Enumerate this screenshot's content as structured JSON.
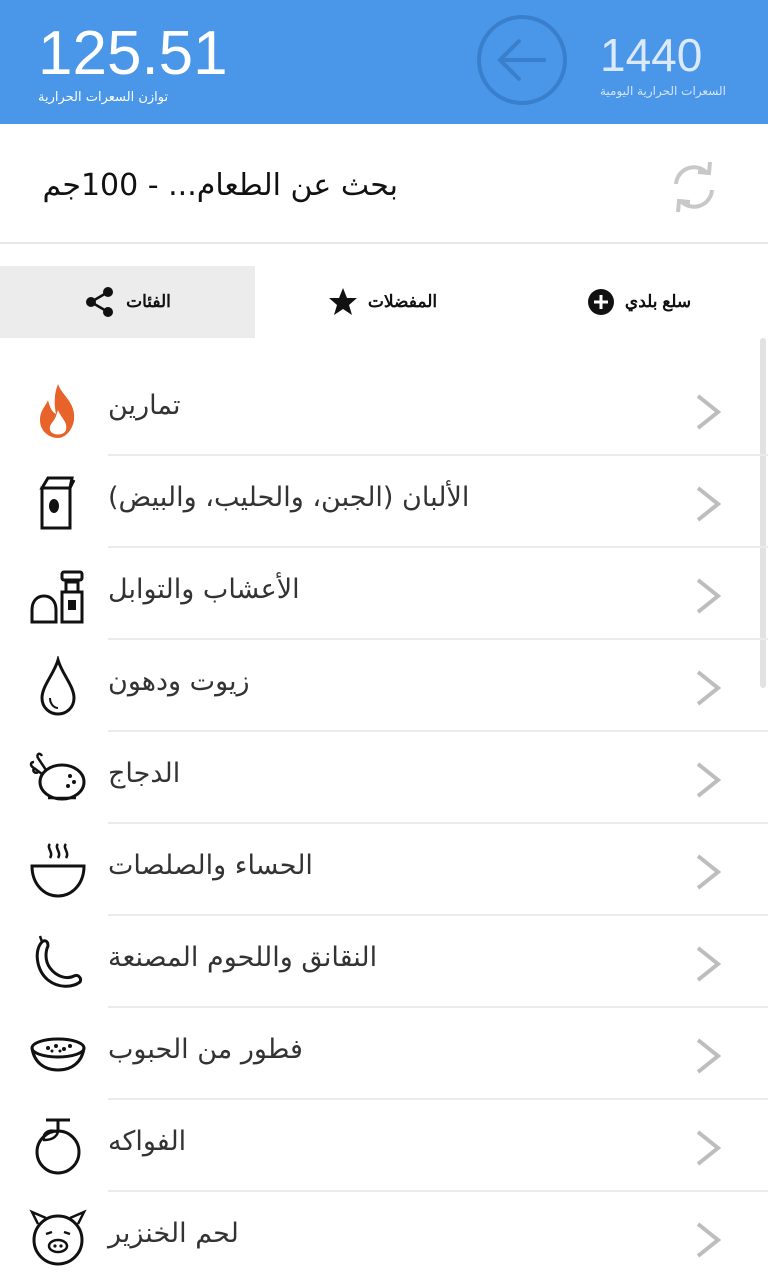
{
  "header": {
    "balance_value": "125.51",
    "balance_label": "توازن السعرات الحرارية",
    "daily_value": "1440",
    "daily_label": "السعرات الحرارية اليومية",
    "back_icon": "arrow-left-circle-icon"
  },
  "search": {
    "text": "بحث عن الطعام... - 100جم",
    "refresh_icon": "refresh-icon"
  },
  "tabs": [
    {
      "label": "الفئات",
      "icon": "share-icon",
      "active": true
    },
    {
      "label": "المفضلات",
      "icon": "star-icon",
      "active": false
    },
    {
      "label": "سلع بلدي",
      "icon": "plus-circle-icon",
      "active": false
    }
  ],
  "categories": [
    {
      "label": "تمارين",
      "icon": "fire-icon"
    },
    {
      "label": "الألبان (الجبن، والحليب، والبيض)",
      "icon": "milk-carton-icon"
    },
    {
      "label": "الأعشاب والتوابل",
      "icon": "spice-grinder-icon"
    },
    {
      "label": "زيوت ودهون",
      "icon": "oil-drop-icon"
    },
    {
      "label": "الدجاج",
      "icon": "roast-chicken-icon"
    },
    {
      "label": "الحساء والصلصات",
      "icon": "soup-bowl-icon"
    },
    {
      "label": "النقانق واللحوم المصنعة",
      "icon": "sausage-icon"
    },
    {
      "label": "فطور من الحبوب",
      "icon": "cereal-bowl-icon"
    },
    {
      "label": "الفواكه",
      "icon": "fruit-icon"
    },
    {
      "label": "لحم الخنزير",
      "icon": "pig-icon"
    }
  ],
  "colors": {
    "header_bg": "#4a97ea",
    "fire_accent": "#e8632a",
    "active_tab_bg": "#ececec"
  }
}
